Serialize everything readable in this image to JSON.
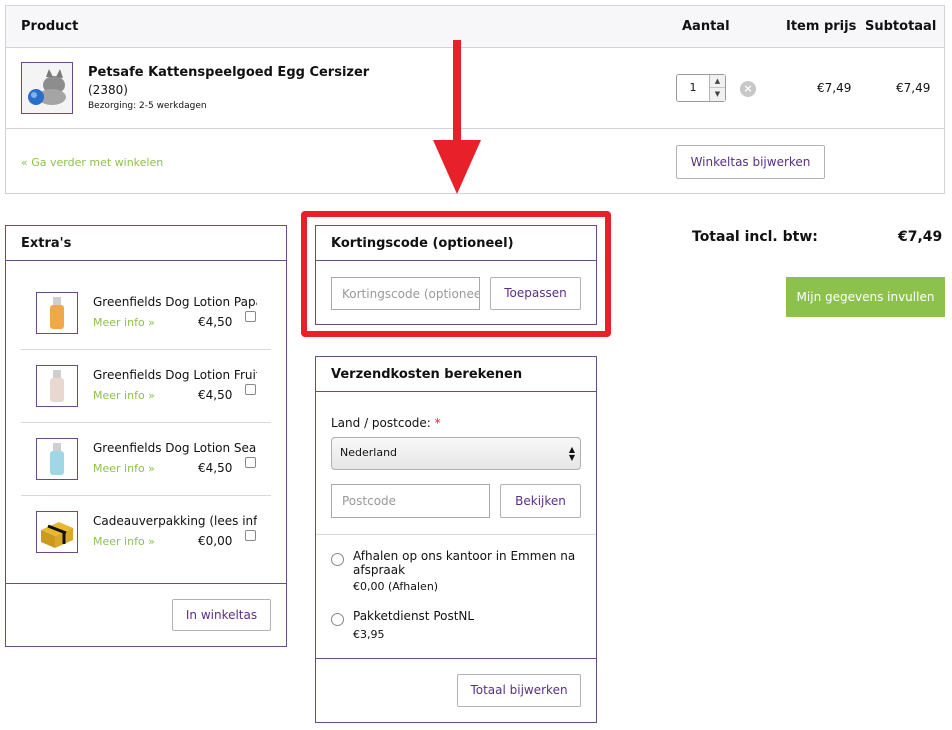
{
  "cart": {
    "headers": {
      "product": "Product",
      "qty": "Aantal",
      "unit_price": "Item prijs",
      "subtotal": "Subtotaal"
    },
    "item": {
      "title": "Petsafe Kattenspeelgoed Egg Cersizer",
      "code": "(2380)",
      "delivery": "Bezorging: 2-5 werkdagen",
      "quantity": "1",
      "unit_price": "€7,49",
      "subtotal": "€7,49"
    },
    "continue_link": "« Ga verder met winkelen",
    "update_button": "Winkeltas bijwerken"
  },
  "extras": {
    "title": "Extra's",
    "items": [
      {
        "name": "Greenfields Dog Lotion Papaya",
        "more": "Meer info »",
        "price": "€4,50"
      },
      {
        "name": "Greenfields Dog Lotion Fruits",
        "more": "Meer info »",
        "price": "€4,50"
      },
      {
        "name": "Greenfields Dog Lotion Sea Breeze",
        "more": "Meer info »",
        "price": "€4,50"
      },
      {
        "name": "Cadeauverpakking (lees info)",
        "more": "Meer info »",
        "price": "€0,00"
      }
    ],
    "add_button": "In winkeltas"
  },
  "coupon": {
    "title": "Kortingscode (optioneel)",
    "placeholder": "Kortingscode (optioneel)",
    "apply_button": "Toepassen"
  },
  "shipping": {
    "title": "Verzendkosten berekenen",
    "country_label": "Land / postcode:",
    "required_mark": "*",
    "country_value": "Nederland",
    "postcode_placeholder": "Postcode",
    "view_button": "Bekijken",
    "options": [
      {
        "label": "Afhalen op ons kantoor in Emmen na afspraak",
        "price": "€0,00 (Afhalen)"
      },
      {
        "label": "Pakketdienst PostNL",
        "price": "€3,95"
      }
    ],
    "update_button": "Totaal bijwerken"
  },
  "totals": {
    "label": "Totaal incl. btw:",
    "value": "€7,49",
    "checkout_button": "Mijn gegevens invullen"
  },
  "colors": {
    "accent": "#6a4a8a",
    "link": "#8dc14e",
    "highlight": "#e8202a"
  }
}
